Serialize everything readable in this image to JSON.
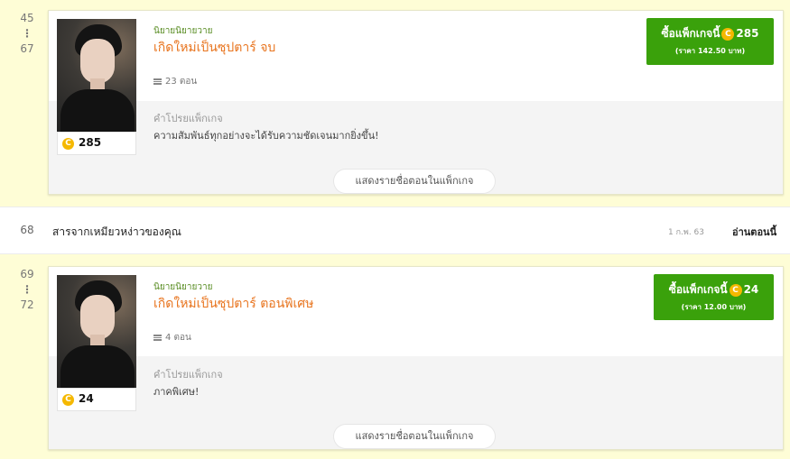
{
  "packages": [
    {
      "range_start": "45",
      "range_end": "67",
      "dots": "⋮",
      "category": "นิยายนิยายวาย",
      "title": "เกิดใหม่เป็นซุปตาร์ จบ",
      "episodes": "23 ตอน",
      "price_coins": "285",
      "buy_label": "ซื้อแพ็กเกจนี้",
      "buy_price_text": "(ราคา 142.50 บาท)",
      "desc_label": "คำโปรยแพ็กเกจ",
      "description": "ความสัมพันธ์ทุกอย่างจะได้รับความชัดเจนมากยิ่งขึ้น!",
      "show_list_label": "แสดงรายชื่อตอนในแพ็กเกจ"
    },
    {
      "range_start": "69",
      "range_end": "72",
      "dots": "⋮",
      "category": "นิยายนิยายวาย",
      "title": "เกิดใหม่เป็นซุปตาร์ ตอนพิเศษ",
      "episodes": "4 ตอน",
      "price_coins": "24",
      "buy_label": "ซื้อแพ็กเกจนี้",
      "buy_price_text": "(ราคา 12.00 บาท)",
      "desc_label": "คำโปรยแพ็กเกจ",
      "description": "ภาคพิเศษ!",
      "show_list_label": "แสดงรายชื่อตอนในแพ็กเกจ"
    }
  ],
  "chapter": {
    "number": "68",
    "title": "สารจากเหมียวหง่าวของคุณ",
    "date": "1 ก.พ. 63",
    "read_label": "อ่านตอนนี้"
  },
  "icons": {
    "coin": "C"
  },
  "colors": {
    "band": "#fefdd6",
    "buy_green": "#3aa10b",
    "title_orange": "#e8741e",
    "category_green": "#558a1e"
  }
}
